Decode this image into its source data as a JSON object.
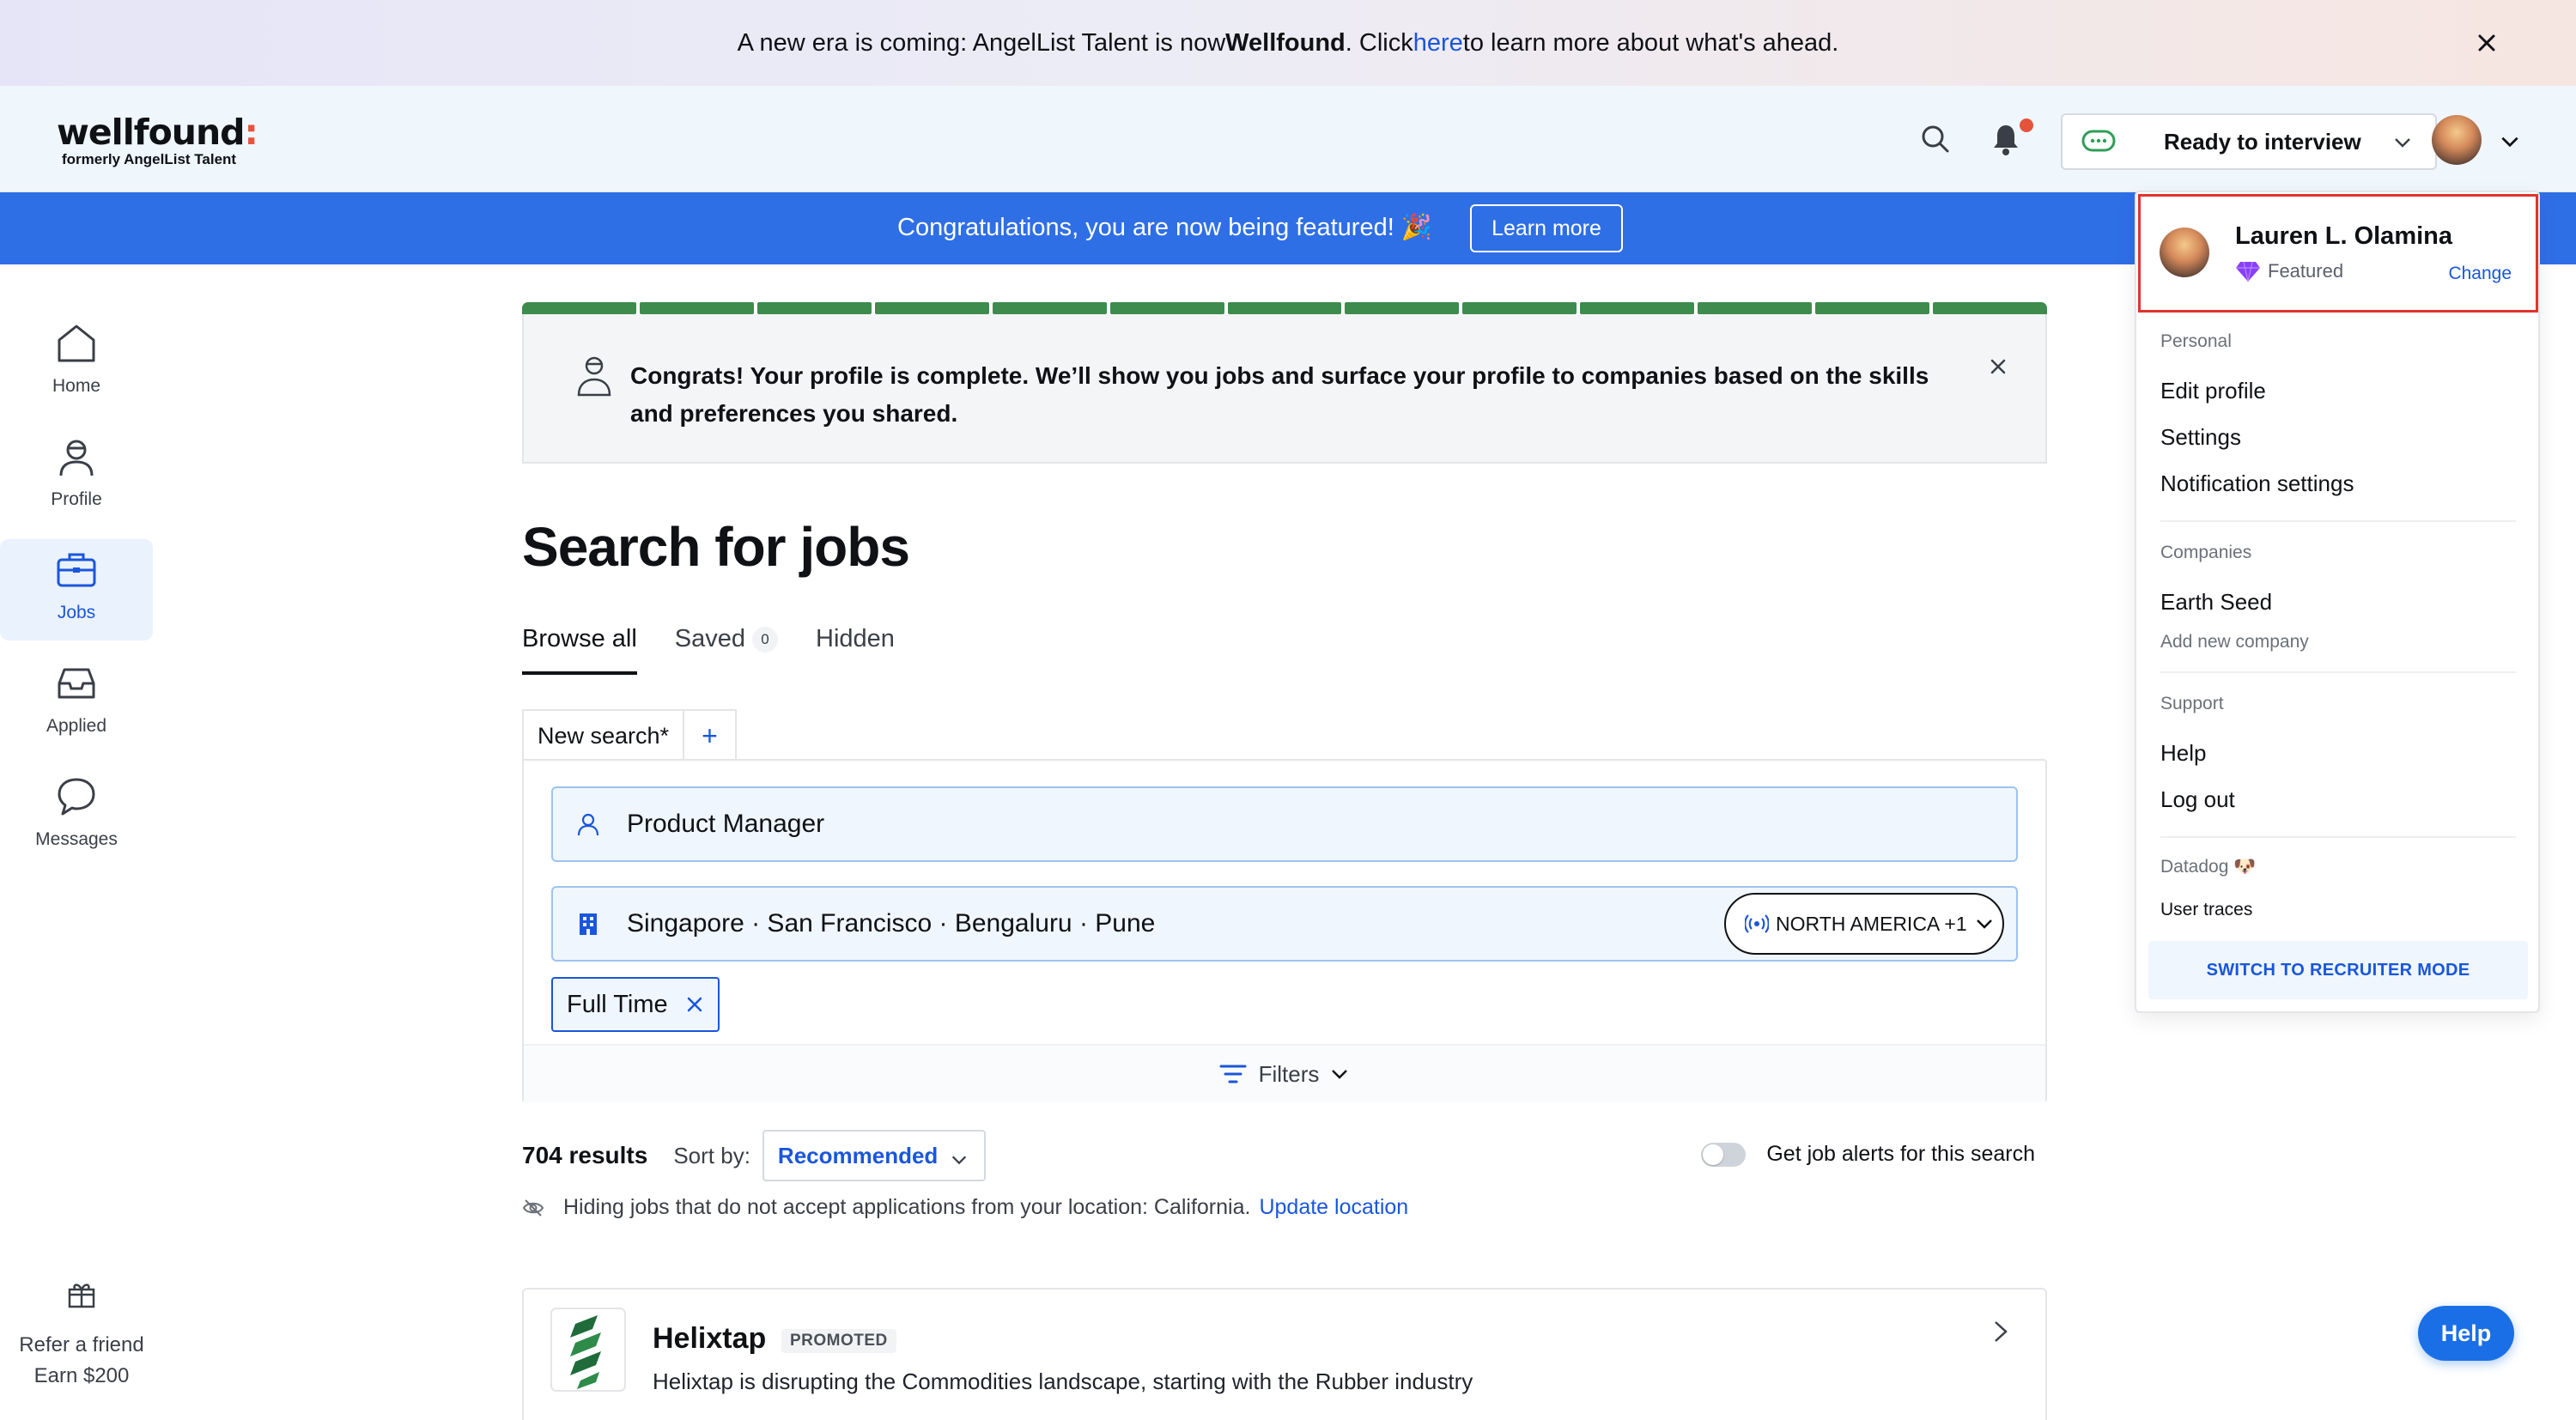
{
  "announcement": {
    "prefix": "A new era is coming: AngelList Talent is now ",
    "brand": "Wellfound",
    "mid": ". Click ",
    "link": "here",
    "suffix": " to learn more about what's ahead."
  },
  "header": {
    "logo": "wellfound",
    "logo_colon": ":",
    "logo_sub": "formerly AngelList Talent",
    "status_label": "Ready to interview"
  },
  "featured_banner": {
    "text": "Congratulations, you are now being featured! 🎉",
    "button": "Learn more"
  },
  "left_nav": {
    "items": [
      {
        "label": "Home"
      },
      {
        "label": "Profile"
      },
      {
        "label": "Jobs"
      },
      {
        "label": "Applied"
      },
      {
        "label": "Messages"
      }
    ],
    "refer_line1": "Refer a friend",
    "refer_line2": "Earn $200"
  },
  "congrats": {
    "message": "Congrats! Your profile is complete. We’ll show you jobs and surface your profile to companies based on the skills and preferences you shared."
  },
  "main": {
    "title": "Search for jobs",
    "tabs": [
      {
        "label": "Browse all"
      },
      {
        "label": "Saved",
        "badge": "0"
      },
      {
        "label": "Hidden"
      }
    ],
    "search_tab": "New search*",
    "search_tab_add": "+",
    "role_field": "Product Manager",
    "location_field": "Singapore · San Francisco · Bengaluru · Pune",
    "region_button": "NORTH AMERICA +1",
    "chip": "Full Time",
    "filters_label": "Filters",
    "results_count": "704 results",
    "sort_label": "Sort by:",
    "sort_value": "Recommended",
    "alerts_label": "Get job alerts for this search",
    "hide_note": "Hiding jobs that do not accept applications from your location: California.",
    "update_location": "Update location"
  },
  "job_card": {
    "company": "Helixtap",
    "tag": "PROMOTED",
    "description": "Helixtap is disrupting the Commodities landscape, starting with the Rubber industry"
  },
  "help_button": "Help",
  "dropdown": {
    "user_name": "Lauren L. Olamina",
    "featured": "Featured",
    "change": "Change",
    "personal_header": "Personal",
    "personal_items": [
      "Edit profile",
      "Settings",
      "Notification settings"
    ],
    "companies_header": "Companies",
    "company_name": "Earth Seed",
    "add_company": "Add new company",
    "support_header": "Support",
    "support_items": [
      "Help",
      "Log out"
    ],
    "datadog_header": "Datadog 🐶",
    "user_traces": "User traces",
    "switch_mode": "SWITCH TO RECRUITER MODE"
  },
  "colors": {
    "accent": "#1a56db",
    "banner": "#2f6fe6",
    "progress": "#3d8b4d",
    "highlight": "#e0342c"
  }
}
